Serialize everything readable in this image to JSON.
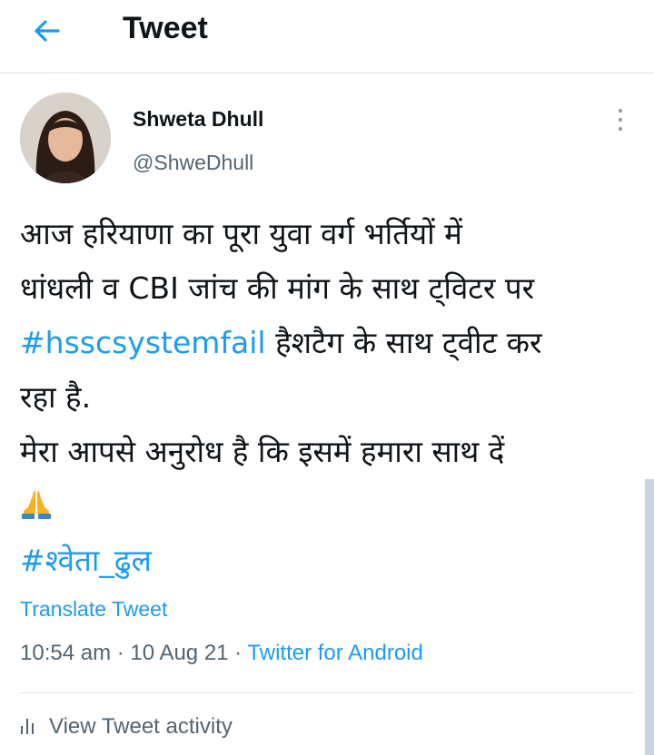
{
  "header": {
    "title": "Tweet"
  },
  "author": {
    "name": "Shweta Dhull",
    "handle": "@ShweDhull"
  },
  "tweet": {
    "line1": "आज हरियाणा का पूरा युवा वर्ग भर्तियों में",
    "line2": "धांधली व CBI जांच की मांग के साथ ट्विटर पर",
    "hashtag1": "#hsscsystemfail",
    "line3_rest": " हैशटैग के साथ ट्वीट कर",
    "line4": "रहा है.",
    "line5": "मेरा आपसे अनुरोध है कि इसमें हमारा साथ दें",
    "emoji": "folded-hands-emoji",
    "hashtag2": "#श्वेता_ढुल"
  },
  "translate_label": "Translate Tweet",
  "meta": {
    "time": "10:54 am",
    "sep1": " · ",
    "date": "10 Aug 21",
    "sep2": " · ",
    "source": "Twitter for Android"
  },
  "activity_label": "View Tweet activity",
  "colors": {
    "link": "#1d9bf0",
    "text": "#0f1419",
    "secondary": "#536471",
    "divider": "#dfe3e6"
  }
}
